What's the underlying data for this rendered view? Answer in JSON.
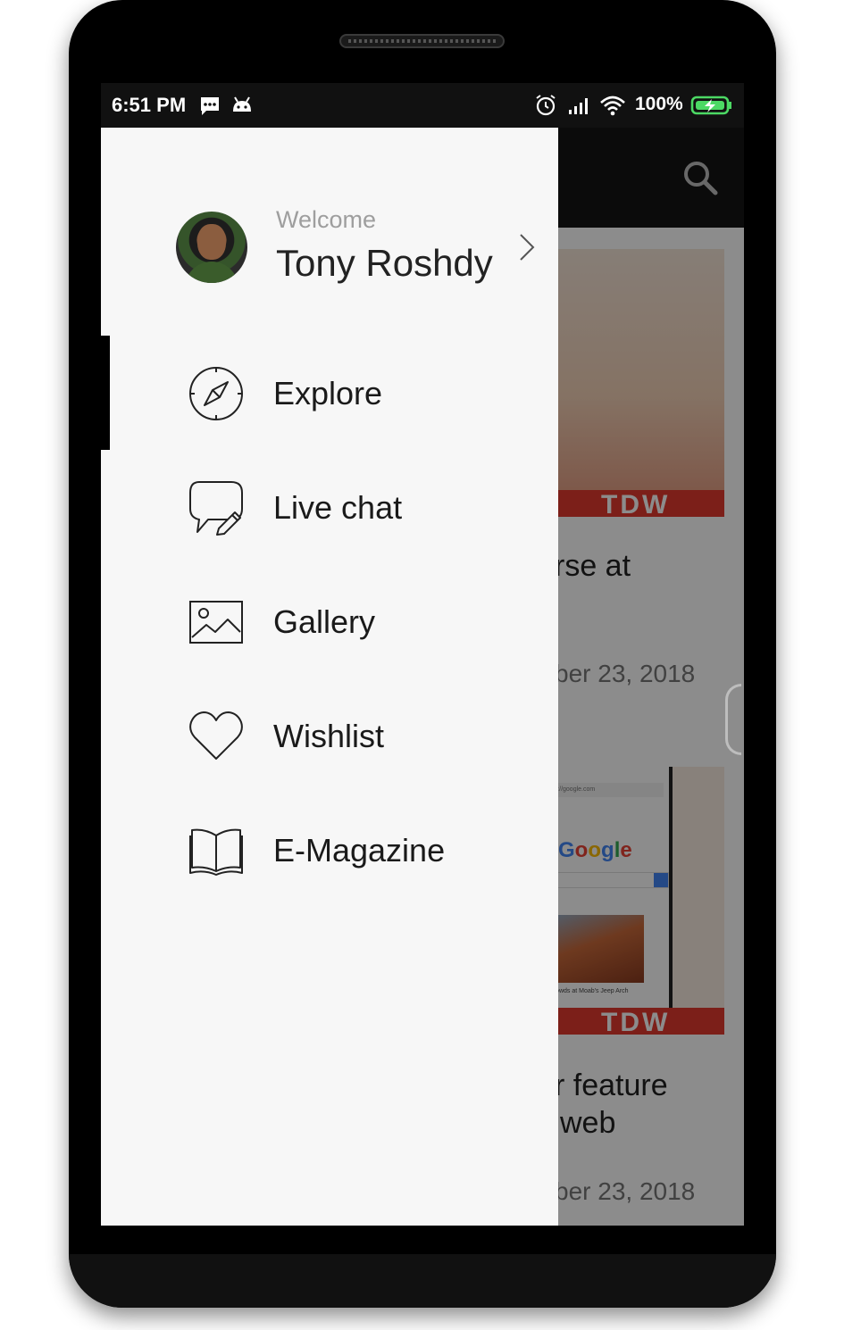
{
  "status_bar": {
    "time": "6:51 PM",
    "battery": "100%"
  },
  "background_app": {
    "card1_tag": "TDW",
    "card1_title_fragment": "rse at",
    "card1_date_fragment": "ber 23, 2018",
    "card2_brand": "Google",
    "card2_url_fragment": "https://google.com",
    "card2_caption_fragment": "the Crowds at Moab's Jeep Arch",
    "card2_tag": "TDW",
    "card2_title_line1": "r feature",
    "card2_title_line2": "web",
    "card2_date_fragment": "ber 23, 2018"
  },
  "drawer": {
    "welcome": "Welcome",
    "user_name": "Tony Roshdy",
    "items": [
      {
        "label": "Explore",
        "icon": "compass-icon"
      },
      {
        "label": "Live chat",
        "icon": "chat-bubble-icon"
      },
      {
        "label": "Gallery",
        "icon": "image-icon"
      },
      {
        "label": "Wishlist",
        "icon": "heart-icon"
      },
      {
        "label": "E-Magazine",
        "icon": "book-icon"
      }
    ],
    "active_item": "Explore"
  },
  "colors": {
    "accent_red": "#e23a2e",
    "drawer_bg": "#f7f7f7",
    "status_bar_bg": "#111111"
  }
}
